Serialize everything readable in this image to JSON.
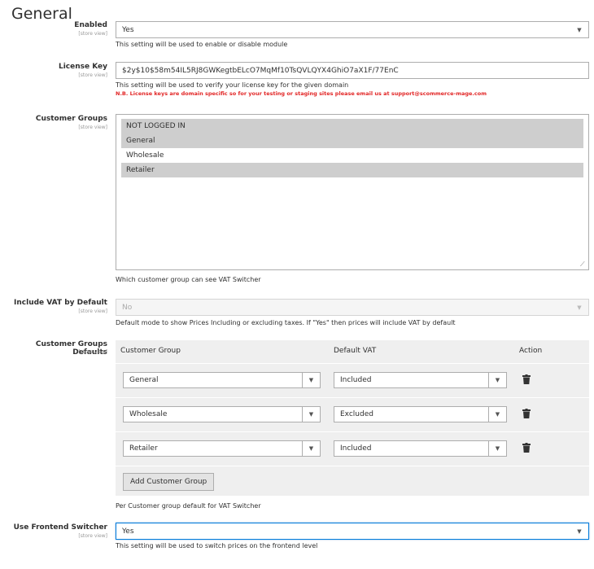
{
  "section": {
    "title": "General"
  },
  "scope_label": "[store view]",
  "enabled": {
    "label": "Enabled",
    "value": "Yes",
    "note": "This setting will be used to enable or disable module"
  },
  "license": {
    "label": "License Key",
    "value": "$2y$10$58m54IL5RJ8GWKegtbELcO7MqMf10TsQVLQYX4GhiO7aX1F/77EnC",
    "note": "This setting will be used to verify your license key for the given domain",
    "warning": "N.B. License keys are domain specific so for your testing or staging sites please email us at support@scommerce-mage.com"
  },
  "customer_groups": {
    "label": "Customer Groups",
    "options": [
      {
        "label": "NOT LOGGED IN",
        "selected": true
      },
      {
        "label": "General",
        "selected": true
      },
      {
        "label": "Wholesale",
        "selected": false
      },
      {
        "label": "Retailer",
        "selected": true
      }
    ],
    "note": "Which customer group can see VAT Switcher"
  },
  "include_vat": {
    "label": "Include VAT by Default",
    "value": "No",
    "note": "Default mode to show Prices Including or excluding taxes. If \"Yes\" then prices will include VAT by default"
  },
  "group_defaults": {
    "label": "Customer Groups Defaults",
    "headers": {
      "group": "Customer Group",
      "vat": "Default VAT",
      "action": "Action"
    },
    "rows": [
      {
        "group": "General",
        "vat": "Included"
      },
      {
        "group": "Wholesale",
        "vat": "Excluded"
      },
      {
        "group": "Retailer",
        "vat": "Included"
      }
    ],
    "add_button": "Add Customer Group",
    "note": "Per Customer group default for VAT Switcher"
  },
  "frontend_switcher": {
    "label": "Use Frontend Switcher",
    "value": "Yes",
    "note": "This setting will be used to switch prices on the frontend level"
  },
  "icons": {
    "dropdown": "chevron-down-icon",
    "delete": "trash-icon",
    "resize": "resize-handle-icon"
  }
}
